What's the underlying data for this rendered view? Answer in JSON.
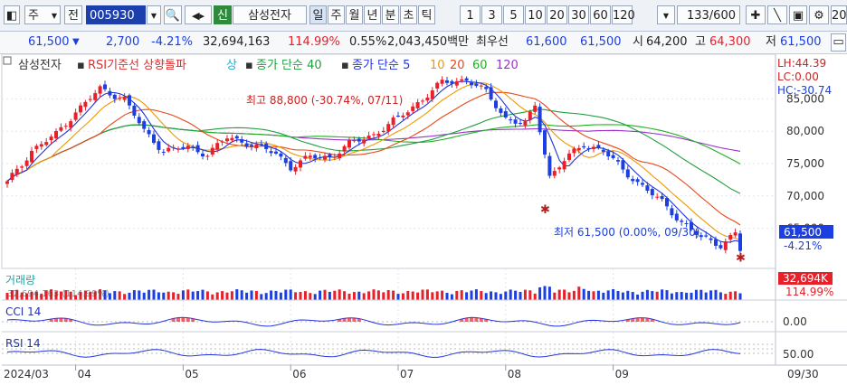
{
  "toolbar": {
    "period_select": "주",
    "prev_label": "전",
    "stock_code": "005930",
    "credit_badge": "신",
    "stock_name": "삼성전자",
    "period_tabs": [
      "일",
      "주",
      "월",
      "년",
      "분",
      "초",
      "틱"
    ],
    "active_period": "일",
    "interval_buttons": [
      "1",
      "3",
      "5",
      "10",
      "20",
      "30",
      "60",
      "120"
    ],
    "count_display": "133/600",
    "right_cut": "20"
  },
  "quote": {
    "price": "61,500",
    "change": "2,700",
    "change_pct": "-4.21%",
    "volume": "32,694,163",
    "vol_ratio": "114.99%",
    "turnover_rate": "0.55%",
    "amount": "2,043,450백만",
    "priority_label": "최우선",
    "best_ask": "61,600",
    "best_bid": "61,500",
    "open_label": "시",
    "open": "64,200",
    "high_label": "고",
    "high": "64,300",
    "low_label": "저",
    "low": "61,500"
  },
  "legend": {
    "stock": "삼성전자",
    "rsi": "RSI기준선 상향돌파",
    "up": "상",
    "ma40": "종가 단순 40",
    "ma_short": "종가 단순 5",
    "p10": "10",
    "p20": "20",
    "p60": "60",
    "p120": "120"
  },
  "info": {
    "lh": "LH:44.39",
    "lc": "LC:0.00",
    "hc": "HC:-30.74"
  },
  "annotations": {
    "high_note": "최고 88,800 (-30.74%, 07/11)",
    "low_note": "최저 61,500 (0.00%, 09/30)"
  },
  "price_box": {
    "price": "61,500",
    "pct": "-4.21%"
  },
  "volume_panel": {
    "title": "거래량",
    "subtitle": "32,694,163 (114.99%)",
    "box": "32,694K",
    "pct": "114.99%"
  },
  "cci_panel": {
    "title": "CCI 14",
    "tick": "0.00"
  },
  "rsi_panel": {
    "title": "RSI 14",
    "tick": "50.00"
  },
  "date_axis": {
    "first": "2024/03",
    "last_label": "09/30"
  },
  "colors": {
    "up": "#e8202a",
    "down": "#1b3fe0",
    "ma5": "#2233dd",
    "ma10": "#ee9900",
    "ma20": "#e84818",
    "ma60": "#20b020",
    "ma120": "#9933cc",
    "ma40": "#20a040"
  },
  "chart_data": {
    "type": "candlestick",
    "price_axis": {
      "ticks": [
        65000,
        70000,
        75000,
        80000,
        85000
      ],
      "range": [
        59500,
        90500
      ]
    },
    "month_labels": [
      "04",
      "05",
      "06",
      "07",
      "08",
      "09"
    ],
    "price_path": [
      [
        0,
        72000
      ],
      [
        5,
        77000
      ],
      [
        10,
        79500
      ],
      [
        14,
        83000
      ],
      [
        19,
        86500
      ],
      [
        24,
        85000
      ],
      [
        28,
        80000
      ],
      [
        32,
        77000
      ],
      [
        37,
        77500
      ],
      [
        41,
        76500
      ],
      [
        45,
        79000
      ],
      [
        50,
        78000
      ],
      [
        55,
        76500
      ],
      [
        58,
        74500
      ],
      [
        62,
        76000
      ],
      [
        66,
        76000
      ],
      [
        70,
        78000
      ],
      [
        75,
        79500
      ],
      [
        80,
        82000
      ],
      [
        85,
        85000
      ],
      [
        89,
        87500
      ],
      [
        94,
        88000
      ],
      [
        98,
        86000
      ],
      [
        102,
        82000
      ],
      [
        106,
        81000
      ],
      [
        108,
        84000
      ],
      [
        111,
        73000
      ],
      [
        114,
        75500
      ],
      [
        118,
        78000
      ],
      [
        122,
        77000
      ],
      [
        126,
        74000
      ],
      [
        130,
        71500
      ],
      [
        134,
        69000
      ],
      [
        138,
        66000
      ],
      [
        142,
        63500
      ],
      [
        146,
        62500
      ],
      [
        149,
        64200
      ],
      [
        150,
        61500
      ]
    ],
    "high_marker": {
      "label_index": 94,
      "value": 88800
    },
    "low_marker": {
      "label_index": 150,
      "value": 61500
    },
    "extra_marker": {
      "label_index": 110,
      "value": 69000
    },
    "last_close": 61500
  }
}
